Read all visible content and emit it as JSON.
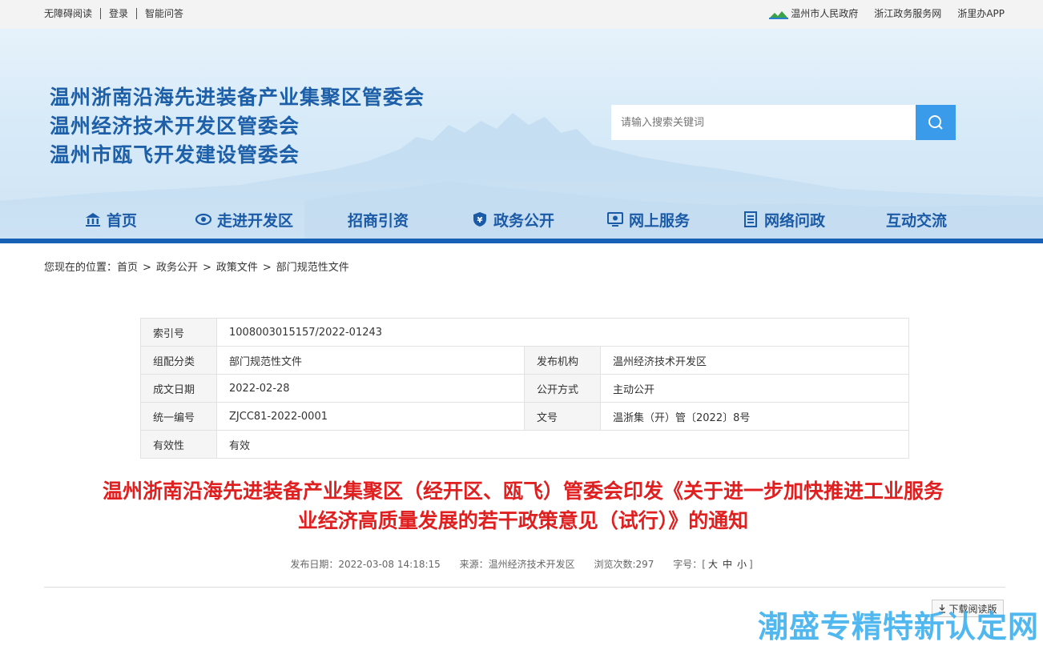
{
  "topbar": {
    "left_links": [
      "无障碍阅读",
      "登录",
      "智能问答"
    ],
    "right_links": [
      "温州市人民政府",
      "浙江政务服务网",
      "浙里办APP"
    ]
  },
  "header": {
    "titles": [
      "温州浙南沿海先进装备产业集聚区管委会",
      "温州经济技术开发区管委会",
      "温州市瓯飞开发建设管委会"
    ],
    "search_placeholder": "请输入搜索关键词"
  },
  "nav": {
    "items": [
      {
        "label": "首页",
        "icon": "home-icon"
      },
      {
        "label": "走进开发区",
        "icon": "eye-icon"
      },
      {
        "label": "招商引资",
        "icon": ""
      },
      {
        "label": "政务公开",
        "icon": "yen-shield-icon"
      },
      {
        "label": "网上服务",
        "icon": "monitor-icon"
      },
      {
        "label": "网络问政",
        "icon": "document-icon"
      },
      {
        "label": "互动交流",
        "icon": ""
      }
    ]
  },
  "breadcrumb": {
    "prefix": "您现在的位置：",
    "items": [
      "首页",
      "政务公开",
      "政策文件",
      "部门规范性文件"
    ],
    "separator": ">"
  },
  "meta": {
    "index_label": "索引号",
    "index_value": "1008003015157/2022-01243",
    "category_label": "组配分类",
    "category_value": "部门规范性文件",
    "publisher_label": "发布机构",
    "publisher_value": "温州经济技术开发区",
    "date_label": "成文日期",
    "date_value": "2022-02-28",
    "public_label": "公开方式",
    "public_value": "主动公开",
    "code_label": "统一编号",
    "code_value": "ZJCC81-2022-0001",
    "docno_label": "文号",
    "docno_value": "温浙集（开）管〔2022〕8号",
    "valid_label": "有效性",
    "valid_value": "有效"
  },
  "article": {
    "title_line1": "温州浙南沿海先进装备产业集聚区（经开区、瓯飞）管委会印发《关于进一步加快推进工业服务",
    "title_line2": "业经济高质量发展的若干政策意见（试行）》的通知",
    "publish_date": "发布日期：2022-03-08 14:18:15",
    "source": "来源：温州经济技术开发区",
    "views": "浏览次数:297",
    "font_label": "字号：",
    "font_open": "[",
    "font_large": "大",
    "font_medium": "中",
    "font_small": "小",
    "font_close": "]",
    "download_label": "下载阅读版"
  },
  "watermark": "潮盛专精特新认定网",
  "colors": {
    "primary": "#1b5aa6",
    "nav_line": "#1660b5",
    "title_red": "#e02020",
    "search_btn": "#3a9bea"
  }
}
